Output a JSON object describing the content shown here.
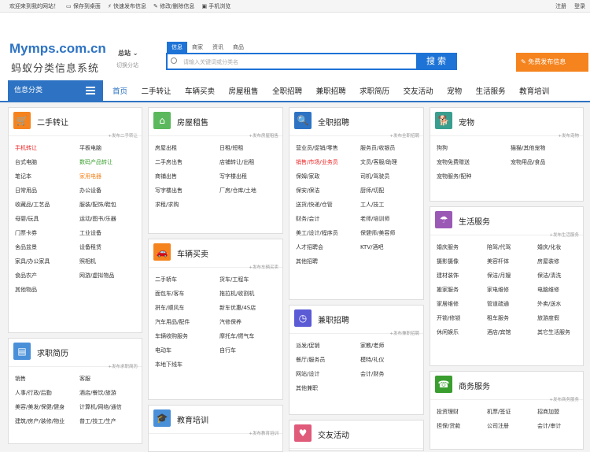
{
  "topbar": {
    "welcome": "欢迎来到我的网站！",
    "save": "保存到桌面",
    "quick": "快速发布信息",
    "edit": "修改/删除信息",
    "mobile": "手机浏览",
    "register": "注册",
    "login": "登录"
  },
  "header": {
    "logo": "Mymps.com.cn",
    "slogan": "蚂蚁分类信息系统",
    "city": "总站",
    "city_switch": "切换分站",
    "search_tabs": [
      "信息",
      "商家",
      "资讯",
      "商品"
    ],
    "search_placeholder": "请输入关键词或分类名",
    "search_btn": "搜索",
    "post_btn": "免费发布信息"
  },
  "nav": {
    "category": "信息分类",
    "links": [
      "首页",
      "二手转让",
      "车辆买卖",
      "房屋租售",
      "全职招聘",
      "兼职招聘",
      "求职简历",
      "交友活动",
      "宠物",
      "生活服务",
      "教育培训"
    ]
  },
  "panels": {
    "ershou": {
      "title": "二手转让",
      "more": "+发布二手转让",
      "items": [
        "手机转让",
        "平板电脑",
        "台式电脑",
        "数码产品转让",
        "笔记本",
        "家用电器",
        "日常用品",
        "办公设备",
        "收藏品/工艺品",
        "服装/配饰/鞋包",
        "母婴/玩具",
        "运动/图书/乐器",
        "门票卡券",
        "工业设备",
        "舍品盆景",
        "设备租赁",
        "家具/办公家具",
        "照相机",
        "食品农产",
        "网游/虚拟物品",
        "其他物品"
      ]
    },
    "qiuzhi": {
      "title": "求职简历",
      "more": "+发布求职简历",
      "items": [
        "销售",
        "客服",
        "人事/行政/后勤",
        "酒店/餐饮/旅游",
        "美容/美发/保健/健身",
        "计算机/网络/通信",
        "建筑/房产/装修/物业",
        "普工/技工/生产"
      ]
    },
    "fangwu": {
      "title": "房屋租售",
      "more": "+发布房屋租售",
      "items": [
        "房屋出租",
        "日租/短租",
        "二手房出售",
        "店铺转让/出租",
        "商铺出售",
        "写字楼出租",
        "写字楼出售",
        "厂房/仓库/土地",
        "求租/求购"
      ]
    },
    "cheliang": {
      "title": "车辆买卖",
      "more": "+发布车辆买卖",
      "items": [
        "二手轿车",
        "货车/工程车",
        "面包车/客车",
        "拖拉机/收割机",
        "拼车/顺风车",
        "新车优惠/4S店",
        "汽车用品/配件",
        "汽修保养",
        "车辆收购服务",
        "摩托车/燃气车",
        "电动车",
        "自行车",
        "本地下线车"
      ]
    },
    "jiaoyu": {
      "title": "教育培训",
      "more": "+发布教育培训"
    },
    "quanzhi": {
      "title": "全职招聘",
      "more": "+发布全职招聘",
      "items": [
        "营业员/促销/零售",
        "服务员/收银员",
        "销售/市场/业务员",
        "文员/客服/助理",
        "保姆/家政",
        "司机/驾驶员",
        "保安/保洁",
        "厨师/切配",
        "送货/快递/仓管",
        "工人/技工",
        "财务/会计",
        "老师/培训师",
        "美工/设计/程序员",
        "保健师/美容师",
        "人才招聘会",
        "KTV/酒吧",
        "其他招聘"
      ]
    },
    "jianzhi": {
      "title": "兼职招聘",
      "more": "+发布兼职招聘",
      "items": [
        "派发/促销",
        "家教/老师",
        "餐厅/服务员",
        "模特/礼仪",
        "网站/设计",
        "会计/财务",
        "其他兼职"
      ]
    },
    "jiaoyou": {
      "title": "交友活动"
    },
    "chongwu": {
      "title": "宠物",
      "more": "+发布宠物",
      "items": [
        "狗狗",
        "猫猫/其他宠物",
        "宠物免费赠送",
        "宠物用品/食品",
        "宠物服务/配种"
      ]
    },
    "shenghuo": {
      "title": "生活服务",
      "more": "+发布生活服务",
      "items": [
        "婚庆服务",
        "陪驾/代驾",
        "婚庆/化妆",
        "摄影摄像",
        "美容杆体",
        "房屋装修",
        "建材装饰",
        "保洁/月嫂",
        "保洁/清洗",
        "搬家服务",
        "家电维修",
        "电脑维修",
        "家居维修",
        "管道疏通",
        "外卖/送水",
        "开锁/修锁",
        "租车服务",
        "旅游度假",
        "休闲娱乐",
        "酒店/宾馆",
        "其它生活服务"
      ]
    },
    "shangwu": {
      "title": "商务服务",
      "more": "+发布商务服务",
      "items": [
        "投资理财",
        "机票/签证",
        "招商加盟",
        "担保/贷款",
        "公司注册",
        "会计/审计"
      ]
    }
  },
  "colors": {
    "blue": "#2e73c3",
    "orange": "#f5841f",
    "red": "#ee2222",
    "green": "#3a9e2f"
  }
}
